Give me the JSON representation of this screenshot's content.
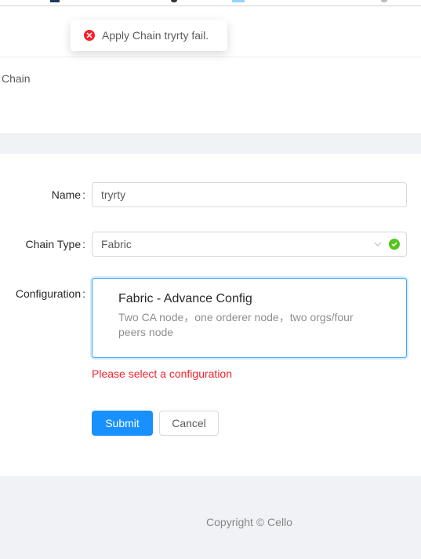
{
  "toast": {
    "message": "Apply Chain tryrty fail.",
    "icon": "close-circle-icon",
    "color": "#f5222d"
  },
  "page_header": {
    "title": "Chain"
  },
  "form": {
    "name": {
      "label": "Name",
      "colon": ":",
      "value": "tryrty"
    },
    "chain_type": {
      "label": "Chain Type",
      "colon": ":",
      "value": "Fabric",
      "status": "success"
    },
    "configuration": {
      "label": "Configuration",
      "colon": ":",
      "option_title": "Fabric - Advance Config",
      "option_description": "Two CA node，one orderer node，two orgs/four peers node",
      "error": "Please select a configuration"
    },
    "submit_label": "Submit",
    "cancel_label": "Cancel"
  },
  "footer": {
    "copyright": "Copyright © Cello"
  },
  "colors": {
    "primary": "#1890ff",
    "error": "#f5222d",
    "success": "#52c41a",
    "focus_border": "#40a9ff"
  }
}
